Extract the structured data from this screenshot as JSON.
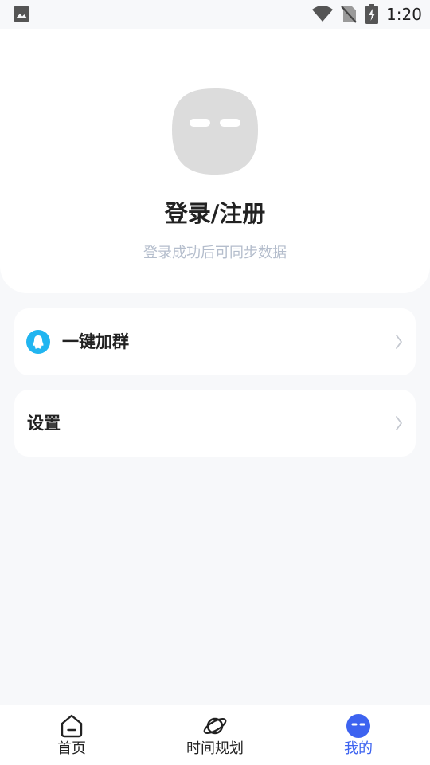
{
  "status_bar": {
    "time": "1:20",
    "icons": [
      "image-icon",
      "wifi-icon",
      "no-sim-icon",
      "battery-charging-icon"
    ]
  },
  "profile": {
    "title": "登录/注册",
    "subtitle": "登录成功后可同步数据",
    "avatar_icon": "avatar-face-icon"
  },
  "menu": {
    "items": [
      {
        "label": "一键加群",
        "icon": "qq-penguin-icon"
      },
      {
        "label": "设置"
      }
    ]
  },
  "tab_bar": {
    "tabs": [
      {
        "label": "首页",
        "icon": "home-icon",
        "active": false
      },
      {
        "label": "时间规划",
        "icon": "planet-icon",
        "active": false
      },
      {
        "label": "我的",
        "icon": "profile-face-icon",
        "active": true
      }
    ]
  },
  "colors": {
    "accent": "#3d63f0",
    "qq_blue": "#21b5f0",
    "subtitle_gray": "#b4bdcc",
    "page_bg": "#f7f8fa"
  }
}
